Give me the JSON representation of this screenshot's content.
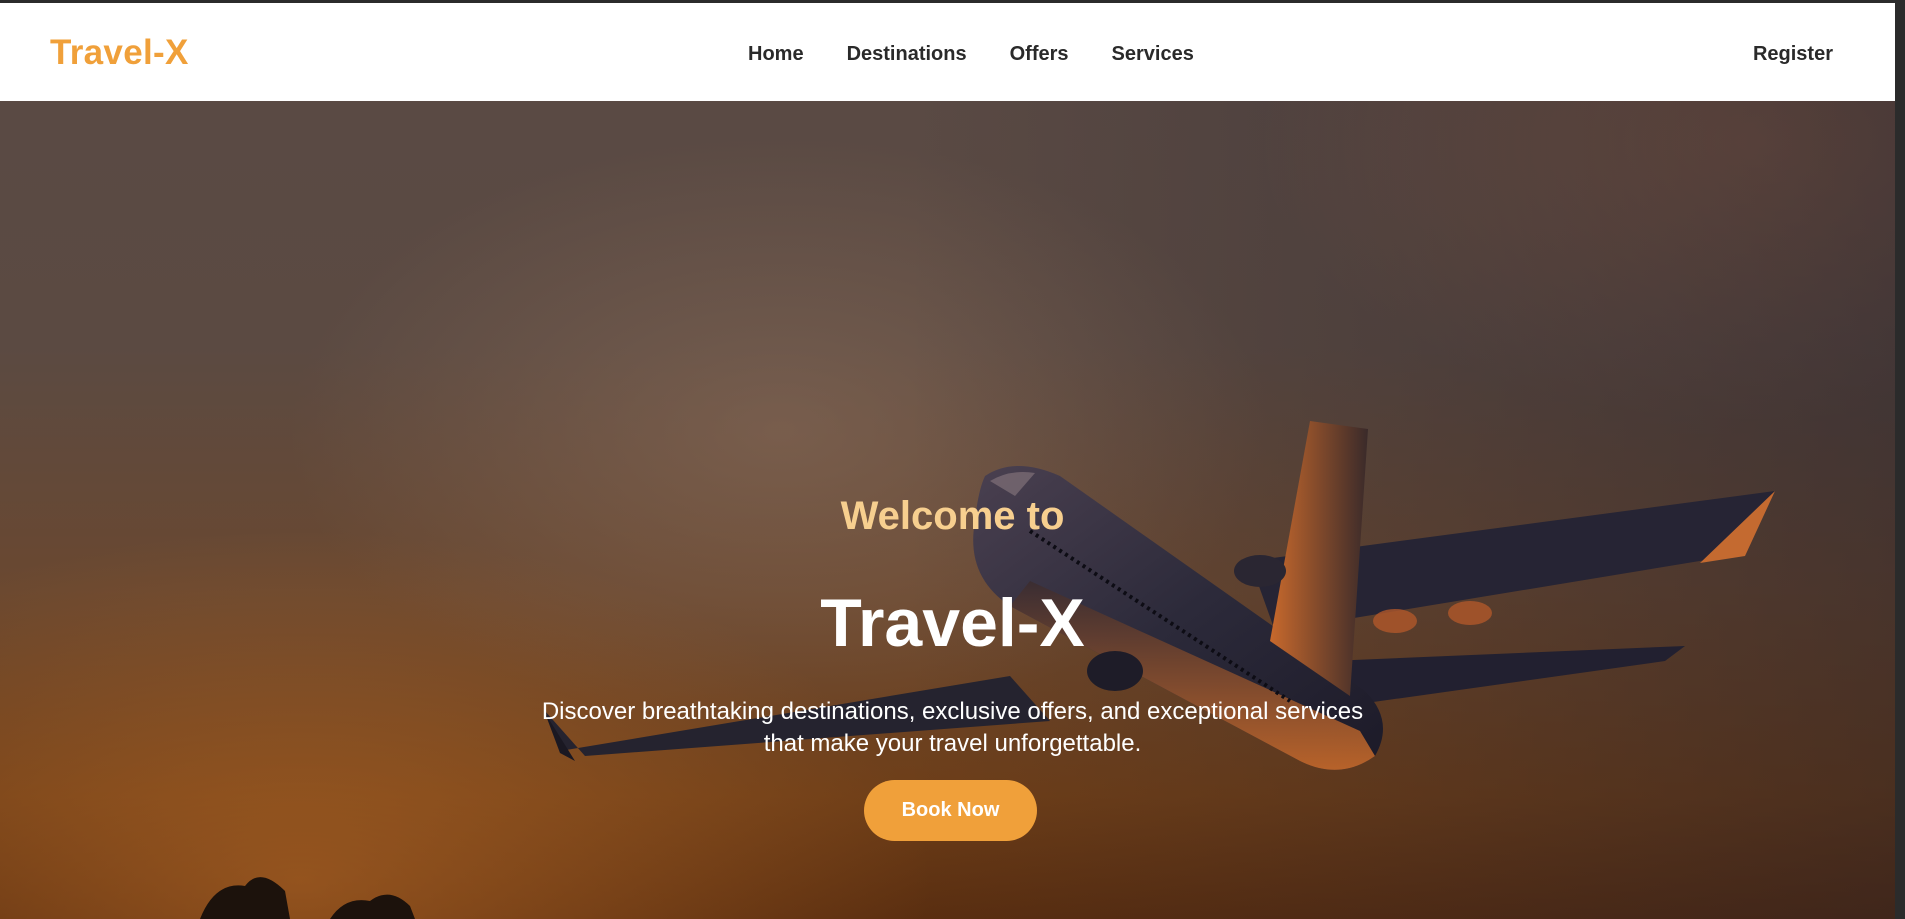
{
  "brand": {
    "logo": "Travel-X",
    "accent_color": "#f0a03a"
  },
  "nav": {
    "links": [
      {
        "label": "Home"
      },
      {
        "label": "Destinations"
      },
      {
        "label": "Offers"
      },
      {
        "label": "Services"
      }
    ],
    "register_label": "Register"
  },
  "hero": {
    "welcome": "Welcome to",
    "title": "Travel-X",
    "tagline": "Discover breathtaking destinations, exclusive offers, and exceptional services that make your travel unforgettable.",
    "cta_label": "Book Now",
    "background_image": "airplane-sunset-photo"
  }
}
